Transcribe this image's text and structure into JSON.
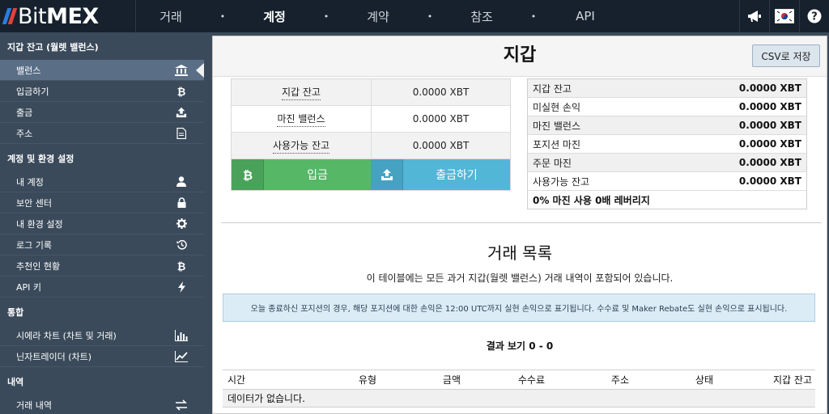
{
  "nav": {
    "logo": {
      "prefix": "Bit",
      "suffix": "MEX"
    },
    "links": [
      "거래",
      "계정",
      "계약",
      "참조",
      "API"
    ],
    "active": "계정",
    "dot": "•",
    "icons": [
      "megaphone-icon",
      "korean-flag-icon",
      "help-icon"
    ]
  },
  "sidebar": {
    "sections": [
      {
        "heading": "지갑 잔고 (월렛 밸런스)",
        "items": [
          {
            "label": "밸런스",
            "icon": "bank-icon",
            "active": true
          },
          {
            "label": "입금하기",
            "icon": "bitcoin-icon"
          },
          {
            "label": "출금",
            "icon": "upload-icon"
          },
          {
            "label": "주소",
            "icon": "document-icon"
          }
        ]
      },
      {
        "heading": "계정 및 환경 설정",
        "items": [
          {
            "label": "내 계정",
            "icon": "user-icon"
          },
          {
            "label": "보안 센터",
            "icon": "lock-icon"
          },
          {
            "label": "내 환경 설정",
            "icon": "gear-icon"
          },
          {
            "label": "로그 기록",
            "icon": "history-icon"
          },
          {
            "label": "추천인 현황",
            "icon": "bitcoin-icon"
          },
          {
            "label": "API 키",
            "icon": "bolt-icon"
          }
        ]
      },
      {
        "heading": "통합",
        "items": [
          {
            "label": "시에라 차트 (차트 및 거래)",
            "icon": "bar-chart-icon"
          },
          {
            "label": "닌자트레이더 (차트)",
            "icon": "line-chart-icon"
          }
        ]
      },
      {
        "heading": "내역",
        "items": [
          {
            "label": "거래 내역",
            "icon": "exchange-icon"
          }
        ]
      }
    ]
  },
  "wallet": {
    "title": "지갑",
    "csv_button": "CSV로 저장",
    "balances": [
      {
        "label": "지갑 잔고",
        "value": "0.0000 XBT"
      },
      {
        "label": "마진 밸런스",
        "value": "0.0000 XBT"
      },
      {
        "label": "사용가능 잔고",
        "value": "0.0000 XBT"
      }
    ],
    "deposit_label": "입금",
    "withdraw_label": "출금하기",
    "summary": [
      {
        "label": "지갑 잔고",
        "value": "0.0000 XBT"
      },
      {
        "label": "미실현 손익",
        "value": "0.0000 XBT"
      },
      {
        "label": "마진 밸런스",
        "value": "0.0000 XBT"
      },
      {
        "label": "포지션 마진",
        "value": "0.0000 XBT"
      },
      {
        "label": "주문 마진",
        "value": "0.0000 XBT"
      },
      {
        "label": "사용가능 잔고",
        "value": "0.0000 XBT"
      }
    ],
    "leverage_note": "0% 마진 사용 0배 레버리지"
  },
  "history": {
    "title": "거래 목록",
    "subtitle": "이 테이블에는 모든 과거 지갑(월렛 밸런스) 거래 내역이 포함되어 있습니다.",
    "info": "오늘 종료하신 포지션의 경우, 해당 포지션에 대한 손익은 12:00 UTC까지 실현 손익으로 표기됩니다. 수수료 및 Maker Rebate도 실현 손익으로 표시됩니다.",
    "result": "결과 보기 0 - 0",
    "columns": [
      "시간",
      "유형",
      "금액",
      "수수료",
      "주소",
      "상태",
      "지갑 잔고"
    ],
    "empty": "데이터가 없습니다."
  },
  "colors": {
    "topbar": "#16212d",
    "sidebar": "#3a4a5a",
    "deposit": "#56b866",
    "withdraw": "#52b6d6"
  }
}
